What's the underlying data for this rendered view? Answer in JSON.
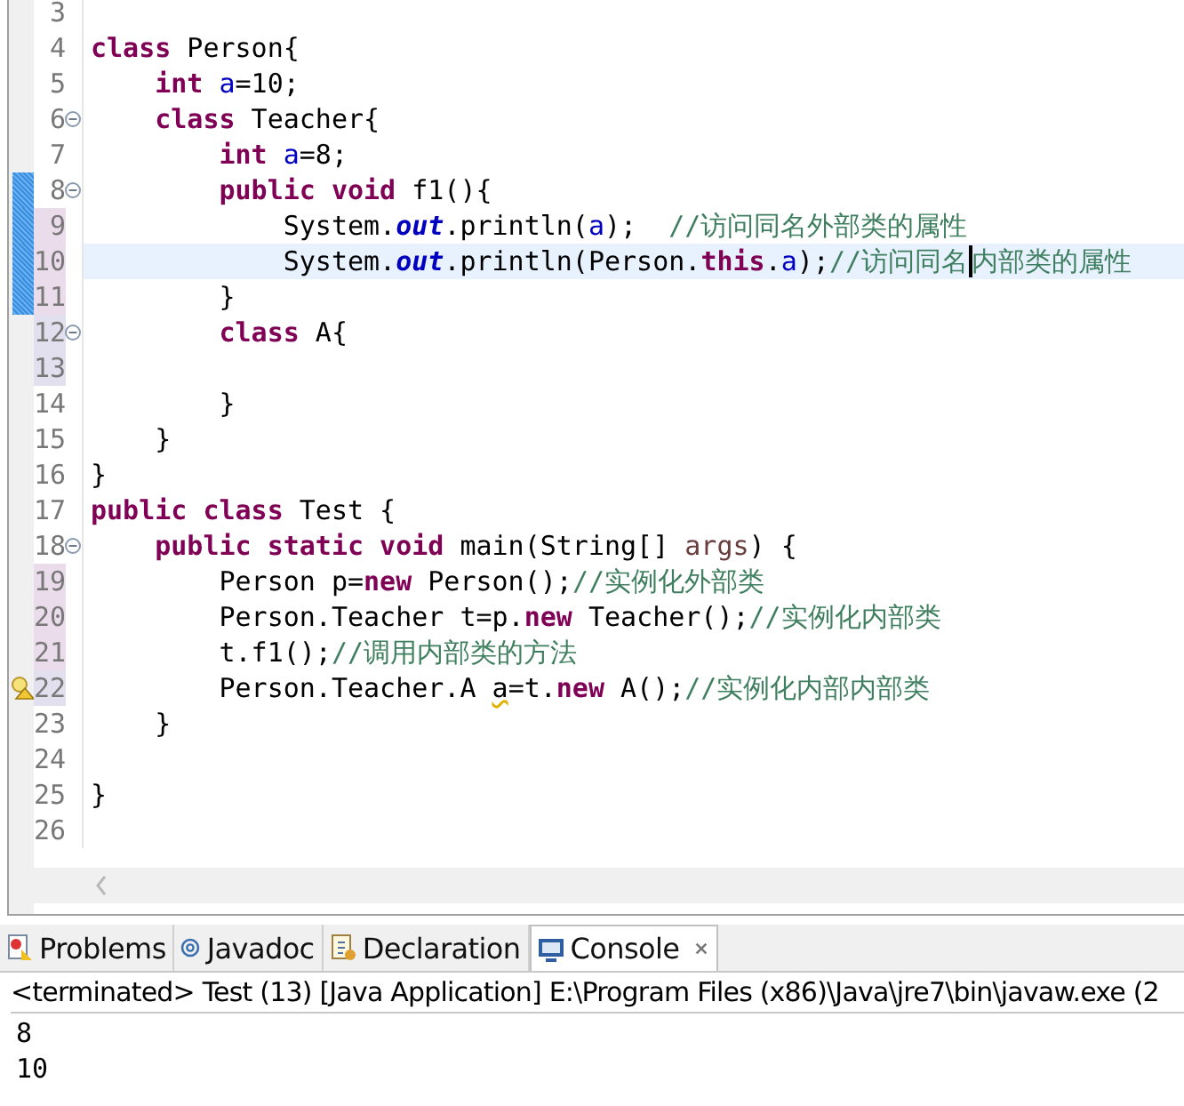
{
  "editor": {
    "lines": [
      {
        "number": "3",
        "fold": false,
        "bar": false,
        "warning": false,
        "current": false,
        "modified": false,
        "added": false
      },
      {
        "number": "4",
        "fold": false,
        "bar": false,
        "warning": false,
        "current": false,
        "modified": false,
        "added": false,
        "tokens": [
          {
            "kind": "keyword",
            "text": "class"
          },
          {
            "kind": "plain",
            "text": " Person{"
          }
        ]
      },
      {
        "number": "5",
        "fold": false,
        "bar": false,
        "warning": false,
        "current": false,
        "modified": false,
        "added": false,
        "tokens": [
          {
            "kind": "keyword",
            "text": "    int "
          },
          {
            "kind": "field",
            "text": "a"
          },
          {
            "kind": "plain",
            "text": "=10;"
          }
        ]
      },
      {
        "number": "6",
        "fold": true,
        "bar": false,
        "warning": false,
        "current": false,
        "modified": false,
        "added": false,
        "tokens": [
          {
            "kind": "keyword",
            "text": "    class"
          },
          {
            "kind": "plain",
            "text": " Teacher{"
          }
        ]
      },
      {
        "number": "7",
        "fold": false,
        "bar": false,
        "warning": false,
        "current": false,
        "modified": false,
        "added": false,
        "tokens": [
          {
            "kind": "keyword",
            "text": "        int "
          },
          {
            "kind": "field",
            "text": "a"
          },
          {
            "kind": "plain",
            "text": "=8;"
          }
        ]
      },
      {
        "number": "8",
        "fold": true,
        "bar": true,
        "warning": false,
        "current": false,
        "modified": false,
        "added": false,
        "tokens": [
          {
            "kind": "keyword",
            "text": "        public void"
          },
          {
            "kind": "plain",
            "text": " f1(){"
          }
        ]
      },
      {
        "number": "9",
        "fold": false,
        "bar": true,
        "warning": false,
        "current": false,
        "modified": true,
        "added": false,
        "tokens": [
          {
            "kind": "plain",
            "text": "            System."
          },
          {
            "kind": "static",
            "text": "out"
          },
          {
            "kind": "plain",
            "text": ".println("
          },
          {
            "kind": "field",
            "text": "a"
          },
          {
            "kind": "plain",
            "text": ");  "
          },
          {
            "kind": "comment",
            "text": "//访问同名外部类的属性"
          }
        ]
      },
      {
        "number": "10",
        "fold": false,
        "bar": true,
        "warning": false,
        "current": true,
        "modified": true,
        "added": false,
        "tokens": [
          {
            "kind": "plain",
            "text": "            System."
          },
          {
            "kind": "static",
            "text": "out"
          },
          {
            "kind": "plain",
            "text": ".println(Person."
          },
          {
            "kind": "keyword",
            "text": "this"
          },
          {
            "kind": "plain",
            "text": "."
          },
          {
            "kind": "field",
            "text": "a"
          },
          {
            "kind": "plain",
            "text": ");"
          },
          {
            "kind": "comment",
            "text": "//访问同名"
          },
          {
            "kind": "caret",
            "text": "内部类的属性"
          }
        ]
      },
      {
        "number": "11",
        "fold": false,
        "bar": true,
        "warning": false,
        "current": false,
        "modified": true,
        "added": false,
        "tokens": [
          {
            "kind": "plain",
            "text": "        }"
          }
        ]
      },
      {
        "number": "12",
        "fold": true,
        "bar": false,
        "warning": false,
        "current": false,
        "modified": false,
        "added": true,
        "tokens": [
          {
            "kind": "keyword",
            "text": "        class"
          },
          {
            "kind": "plain",
            "text": " A{"
          }
        ]
      },
      {
        "number": "13",
        "fold": false,
        "bar": false,
        "warning": false,
        "current": false,
        "modified": false,
        "added": true
      },
      {
        "number": "14",
        "fold": false,
        "bar": false,
        "warning": false,
        "current": false,
        "modified": false,
        "added": false,
        "tokens": [
          {
            "kind": "plain",
            "text": "        }"
          }
        ]
      },
      {
        "number": "15",
        "fold": false,
        "bar": false,
        "warning": false,
        "current": false,
        "modified": false,
        "added": false,
        "tokens": [
          {
            "kind": "plain",
            "text": "    }"
          }
        ]
      },
      {
        "number": "16",
        "fold": false,
        "bar": false,
        "warning": false,
        "current": false,
        "modified": false,
        "added": false,
        "tokens": [
          {
            "kind": "plain",
            "text": "}"
          }
        ]
      },
      {
        "number": "17",
        "fold": false,
        "bar": false,
        "warning": false,
        "current": false,
        "modified": false,
        "added": false,
        "tokens": [
          {
            "kind": "keyword",
            "text": "public class"
          },
          {
            "kind": "plain",
            "text": " Test {"
          }
        ]
      },
      {
        "number": "18",
        "fold": true,
        "bar": false,
        "warning": false,
        "current": false,
        "modified": false,
        "added": false,
        "tokens": [
          {
            "kind": "keyword",
            "text": "    public static void"
          },
          {
            "kind": "plain",
            "text": " main(String[] "
          },
          {
            "kind": "param",
            "text": "args"
          },
          {
            "kind": "plain",
            "text": ") {"
          }
        ]
      },
      {
        "number": "19",
        "fold": false,
        "bar": false,
        "warning": false,
        "current": false,
        "modified": true,
        "added": false,
        "tokens": [
          {
            "kind": "plain",
            "text": "        Person p="
          },
          {
            "kind": "keyword",
            "text": "new"
          },
          {
            "kind": "plain",
            "text": " Person();"
          },
          {
            "kind": "comment",
            "text": "//实例化外部类"
          }
        ]
      },
      {
        "number": "20",
        "fold": false,
        "bar": false,
        "warning": false,
        "current": false,
        "modified": true,
        "added": false,
        "tokens": [
          {
            "kind": "plain",
            "text": "        Person.Teacher t=p."
          },
          {
            "kind": "keyword",
            "text": "new"
          },
          {
            "kind": "plain",
            "text": " Teacher();"
          },
          {
            "kind": "comment",
            "text": "//实例化内部类"
          }
        ]
      },
      {
        "number": "21",
        "fold": false,
        "bar": false,
        "warning": false,
        "current": false,
        "modified": true,
        "added": false,
        "tokens": [
          {
            "kind": "plain",
            "text": "        t.f1();"
          },
          {
            "kind": "comment",
            "text": "//调用内部类的方法"
          }
        ]
      },
      {
        "number": "22",
        "fold": false,
        "bar": false,
        "warning": true,
        "current": false,
        "modified": false,
        "added": true,
        "tokens": [
          {
            "kind": "plain",
            "text": "        Person.Teacher.A "
          },
          {
            "kind": "warn",
            "text": "a"
          },
          {
            "kind": "plain",
            "text": "=t."
          },
          {
            "kind": "keyword",
            "text": "new"
          },
          {
            "kind": "plain",
            "text": " A();"
          },
          {
            "kind": "comment",
            "text": "//实例化内部内部类"
          }
        ]
      },
      {
        "number": "23",
        "fold": false,
        "bar": false,
        "warning": false,
        "current": false,
        "modified": false,
        "added": false,
        "tokens": [
          {
            "kind": "plain",
            "text": "    }"
          }
        ]
      },
      {
        "number": "24",
        "fold": false,
        "bar": false,
        "warning": false,
        "current": false,
        "modified": false,
        "added": false
      },
      {
        "number": "25",
        "fold": false,
        "bar": false,
        "warning": false,
        "current": false,
        "modified": false,
        "added": false,
        "tokens": [
          {
            "kind": "plain",
            "text": "}"
          }
        ]
      },
      {
        "number": "26",
        "fold": false,
        "bar": false,
        "warning": false,
        "current": false,
        "modified": false,
        "added": false
      }
    ]
  },
  "tabs": [
    {
      "label": "Problems",
      "kind": "problems",
      "selected": false,
      "closable": false
    },
    {
      "label": "Javadoc",
      "kind": "javadoc",
      "selected": false,
      "closable": false
    },
    {
      "label": "Declaration",
      "kind": "declaration",
      "selected": false,
      "closable": false
    },
    {
      "label": "Console",
      "kind": "console",
      "selected": true,
      "closable": true
    }
  ],
  "console": {
    "header": "<terminated> Test (13) [Java Application] E:\\Program Files (x86)\\Java\\jre7\\bin\\javaw.exe (2",
    "output": [
      "8",
      "10"
    ]
  }
}
